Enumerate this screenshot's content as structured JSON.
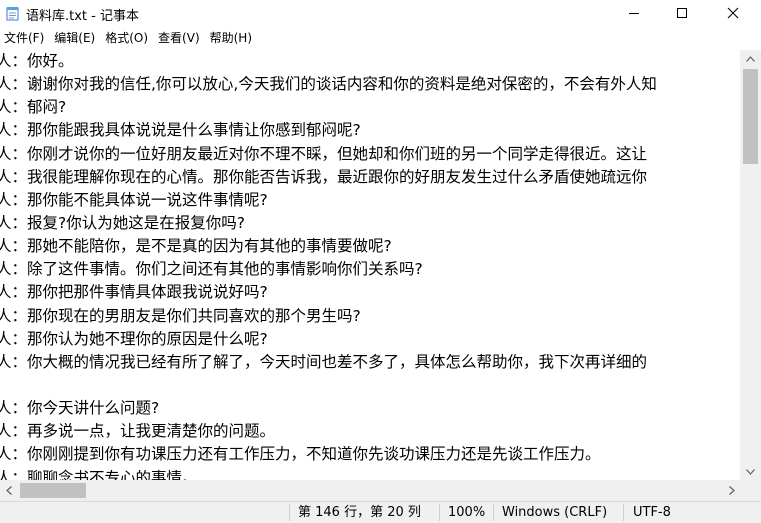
{
  "window": {
    "title": "语料库.txt - 记事本",
    "app_icon": "notepad-icon",
    "controls": {
      "minimize_icon": "minimize-icon",
      "maximize_icon": "maximize-icon",
      "close_icon": "close-icon"
    }
  },
  "menu": [
    {
      "label": "文件(F)"
    },
    {
      "label": "编辑(E)"
    },
    {
      "label": "格式(O)"
    },
    {
      "label": "查看(V)"
    },
    {
      "label": "帮助(H)"
    }
  ],
  "editor": {
    "lines": [
      "人：你好。",
      "人：谢谢你对我的信任,你可以放心,今天我们的谈话内容和你的资料是绝对保密的，不会有外人知",
      "人：郁闷?",
      "人：那你能跟我具体说说是什么事情让你感到郁闷呢?",
      "人：你刚才说你的一位好朋友最近对你不理不睬，但她却和你们班的另一个同学走得很近。这让",
      "人：我很能理解你现在的心情。那你能否告诉我，最近跟你的好朋友发生过什么矛盾使她疏远你",
      "人：那你能不能具体说一说这件事情呢?",
      "人：报复?你认为她这是在报复你吗?",
      "人：那她不能陪你，是不是真的因为有其他的事情要做呢?",
      "人：除了这件事情。你们之间还有其他的事情影响你们关系吗?",
      "人：那你把那件事情具体跟我说说好吗?",
      "人：那你现在的男朋友是你们共同喜欢的那个男生吗?",
      "人：那你认为她不理你的原因是什么呢?",
      "人：你大概的情况我已经有所了解了，今天时间也差不多了，具体怎么帮助你，我下次再详细的",
      "",
      "人：你今天讲什么问题?",
      "人：再多说一点，让我更清楚你的问题。",
      "人：你刚刚提到你有功课压力还有工作压力，不知道你先谈功课压力还是先谈工作压力。",
      "人：聊聊念书不专心的事情。"
    ]
  },
  "scrollbars": {
    "up_icon": "scroll-up-arrow-icon",
    "down_icon": "scroll-down-arrow-icon",
    "left_icon": "scroll-left-arrow-icon",
    "right_icon": "scroll-right-arrow-icon"
  },
  "status": {
    "position": "第 146 行，第 20 列",
    "zoom": "100%",
    "line_ending": "Windows (CRLF)",
    "encoding": "UTF-8"
  }
}
